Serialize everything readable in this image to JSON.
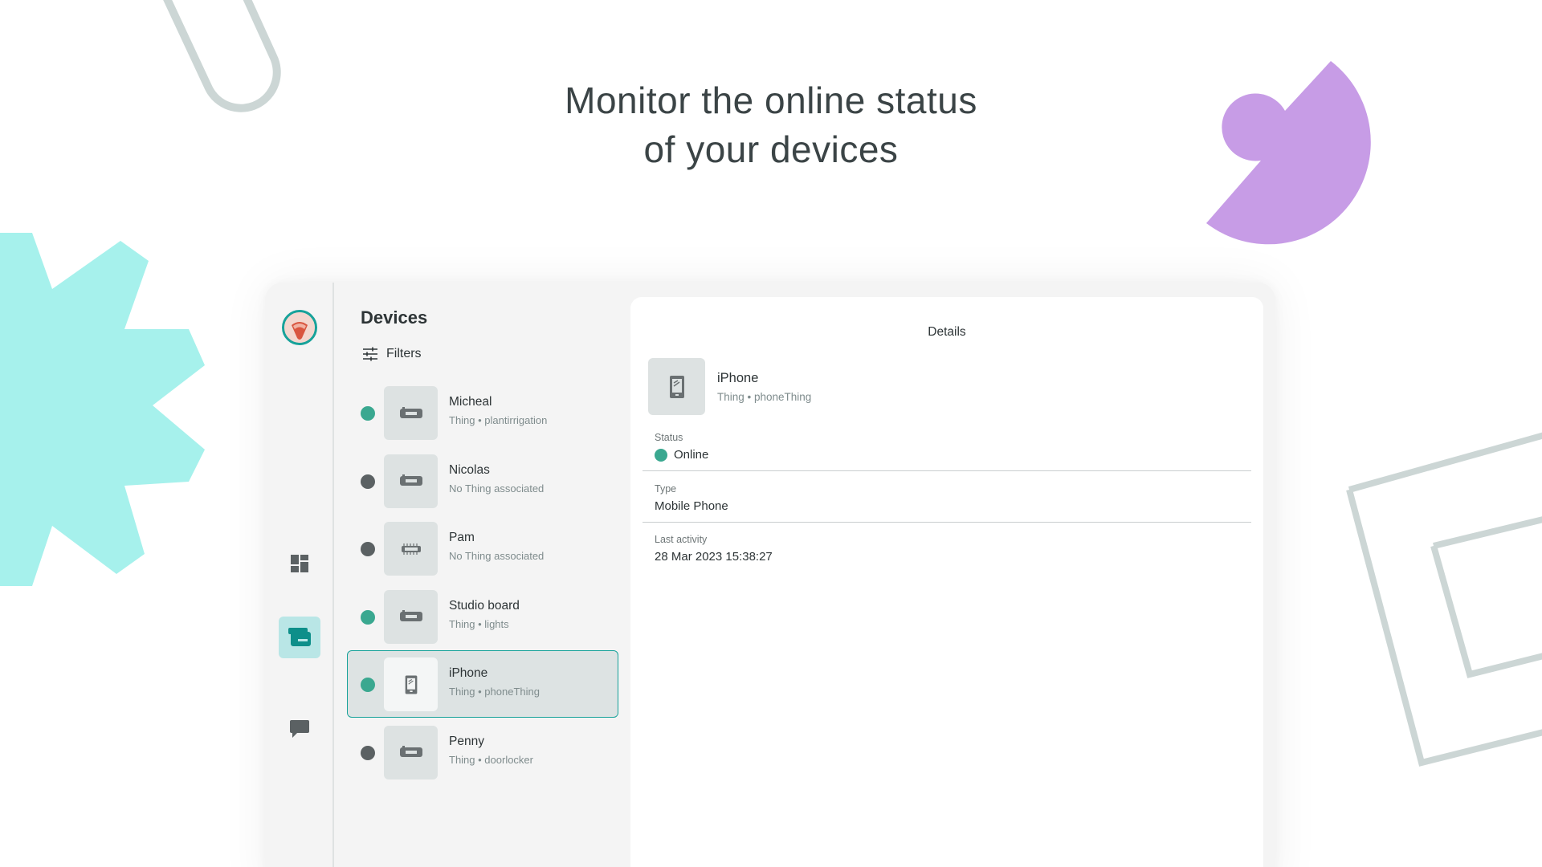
{
  "hero": {
    "line1": "Monitor the online status",
    "line2": "of your devices"
  },
  "colors": {
    "accent": "#17a29a",
    "online": "#3aa890",
    "offline": "#5b6163",
    "deco_teal": "#a6f1ec",
    "deco_purple": "#c79ce6",
    "deco_grey": "#ccd6d5"
  },
  "rail": {
    "items": [
      {
        "icon": "dashboard-icon"
      },
      {
        "icon": "devices-icon",
        "active": true
      },
      {
        "icon": "chat-icon"
      }
    ]
  },
  "list": {
    "title": "Devices",
    "filters_label": "Filters",
    "devices": [
      {
        "name": "Micheal",
        "subtitle": "Thing • plantirrigation",
        "status": "online",
        "icon": "board-icon"
      },
      {
        "name": "Nicolas",
        "subtitle": "No Thing associated",
        "status": "offline",
        "icon": "board-icon"
      },
      {
        "name": "Pam",
        "subtitle": "No Thing associated",
        "status": "offline",
        "icon": "chip-icon"
      },
      {
        "name": "Studio board",
        "subtitle": "Thing • lights",
        "status": "online",
        "icon": "board-icon"
      },
      {
        "name": "iPhone",
        "subtitle": "Thing • phoneThing",
        "status": "online",
        "icon": "phone-icon",
        "selected": true
      },
      {
        "name": "Penny",
        "subtitle": "Thing • doorlocker",
        "status": "offline",
        "icon": "board-icon"
      }
    ]
  },
  "details": {
    "title": "Details",
    "device_name": "iPhone",
    "device_sub": "Thing • phoneThing",
    "status_label": "Status",
    "status_value": "Online",
    "type_label": "Type",
    "type_value": "Mobile Phone",
    "activity_label": "Last activity",
    "activity_value": "28 Mar 2023 15:38:27"
  }
}
